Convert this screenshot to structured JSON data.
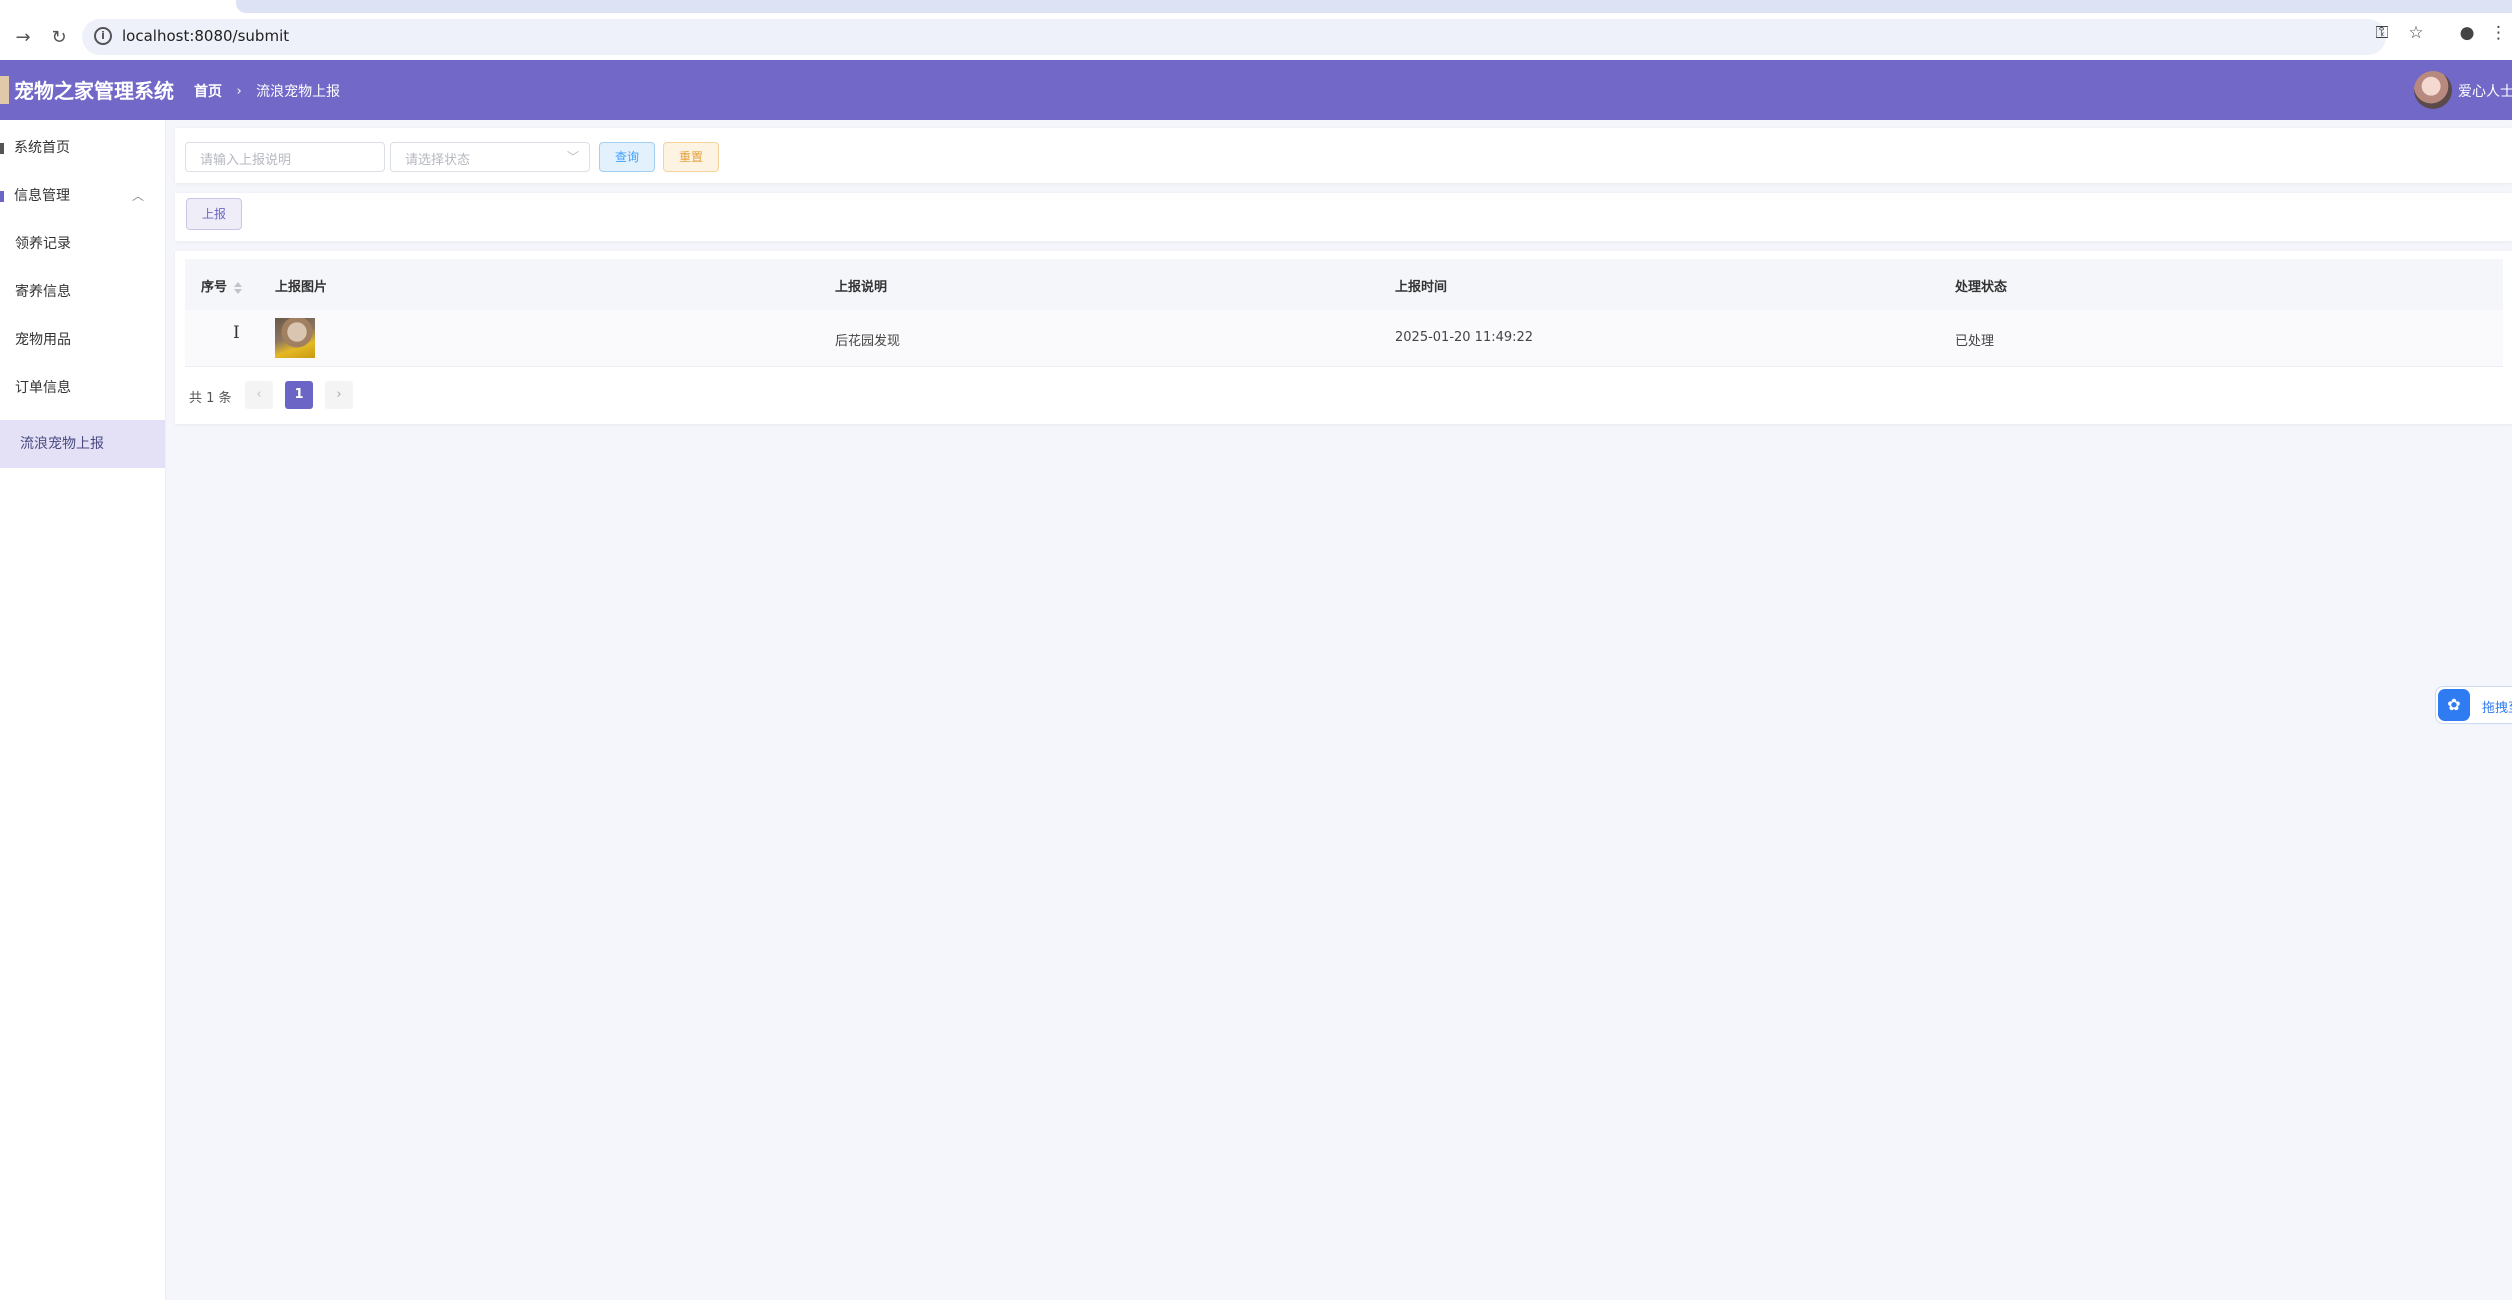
{
  "browser": {
    "url": "localhost:8080/submit"
  },
  "header": {
    "app_title": "宠物之家管理系统",
    "breadcrumb": [
      "首页",
      "流浪宠物上报"
    ],
    "user_name": "爱心人士"
  },
  "sidebar": {
    "items": [
      {
        "label": "系统首页"
      },
      {
        "label": "信息管理"
      },
      {
        "label": "领养记录"
      },
      {
        "label": "寄养信息"
      },
      {
        "label": "宠物用品"
      },
      {
        "label": "订单信息"
      },
      {
        "label": "流浪宠物上报"
      }
    ]
  },
  "search": {
    "description_placeholder": "请输入上报说明",
    "status_placeholder": "请选择状态",
    "query_label": "查询",
    "reset_label": "重置"
  },
  "actions": {
    "report_label": "上报"
  },
  "table": {
    "columns": [
      "序号",
      "上报图片",
      "上报说明",
      "上报时间",
      "处理状态"
    ],
    "rows": [
      {
        "index": "1",
        "description": "后花园发现",
        "time": "2025-01-20 11:49:22",
        "status": "已处理"
      }
    ]
  },
  "pagination": {
    "total_text": "共 1 条",
    "current_page": "1",
    "prev": "‹",
    "next": "›"
  },
  "float_widget": {
    "text": "拖拽至"
  },
  "colors": {
    "brand": "#7268c8",
    "page_bg": "#f5f6fb",
    "active_menu_bg": "#e4e1f7"
  }
}
